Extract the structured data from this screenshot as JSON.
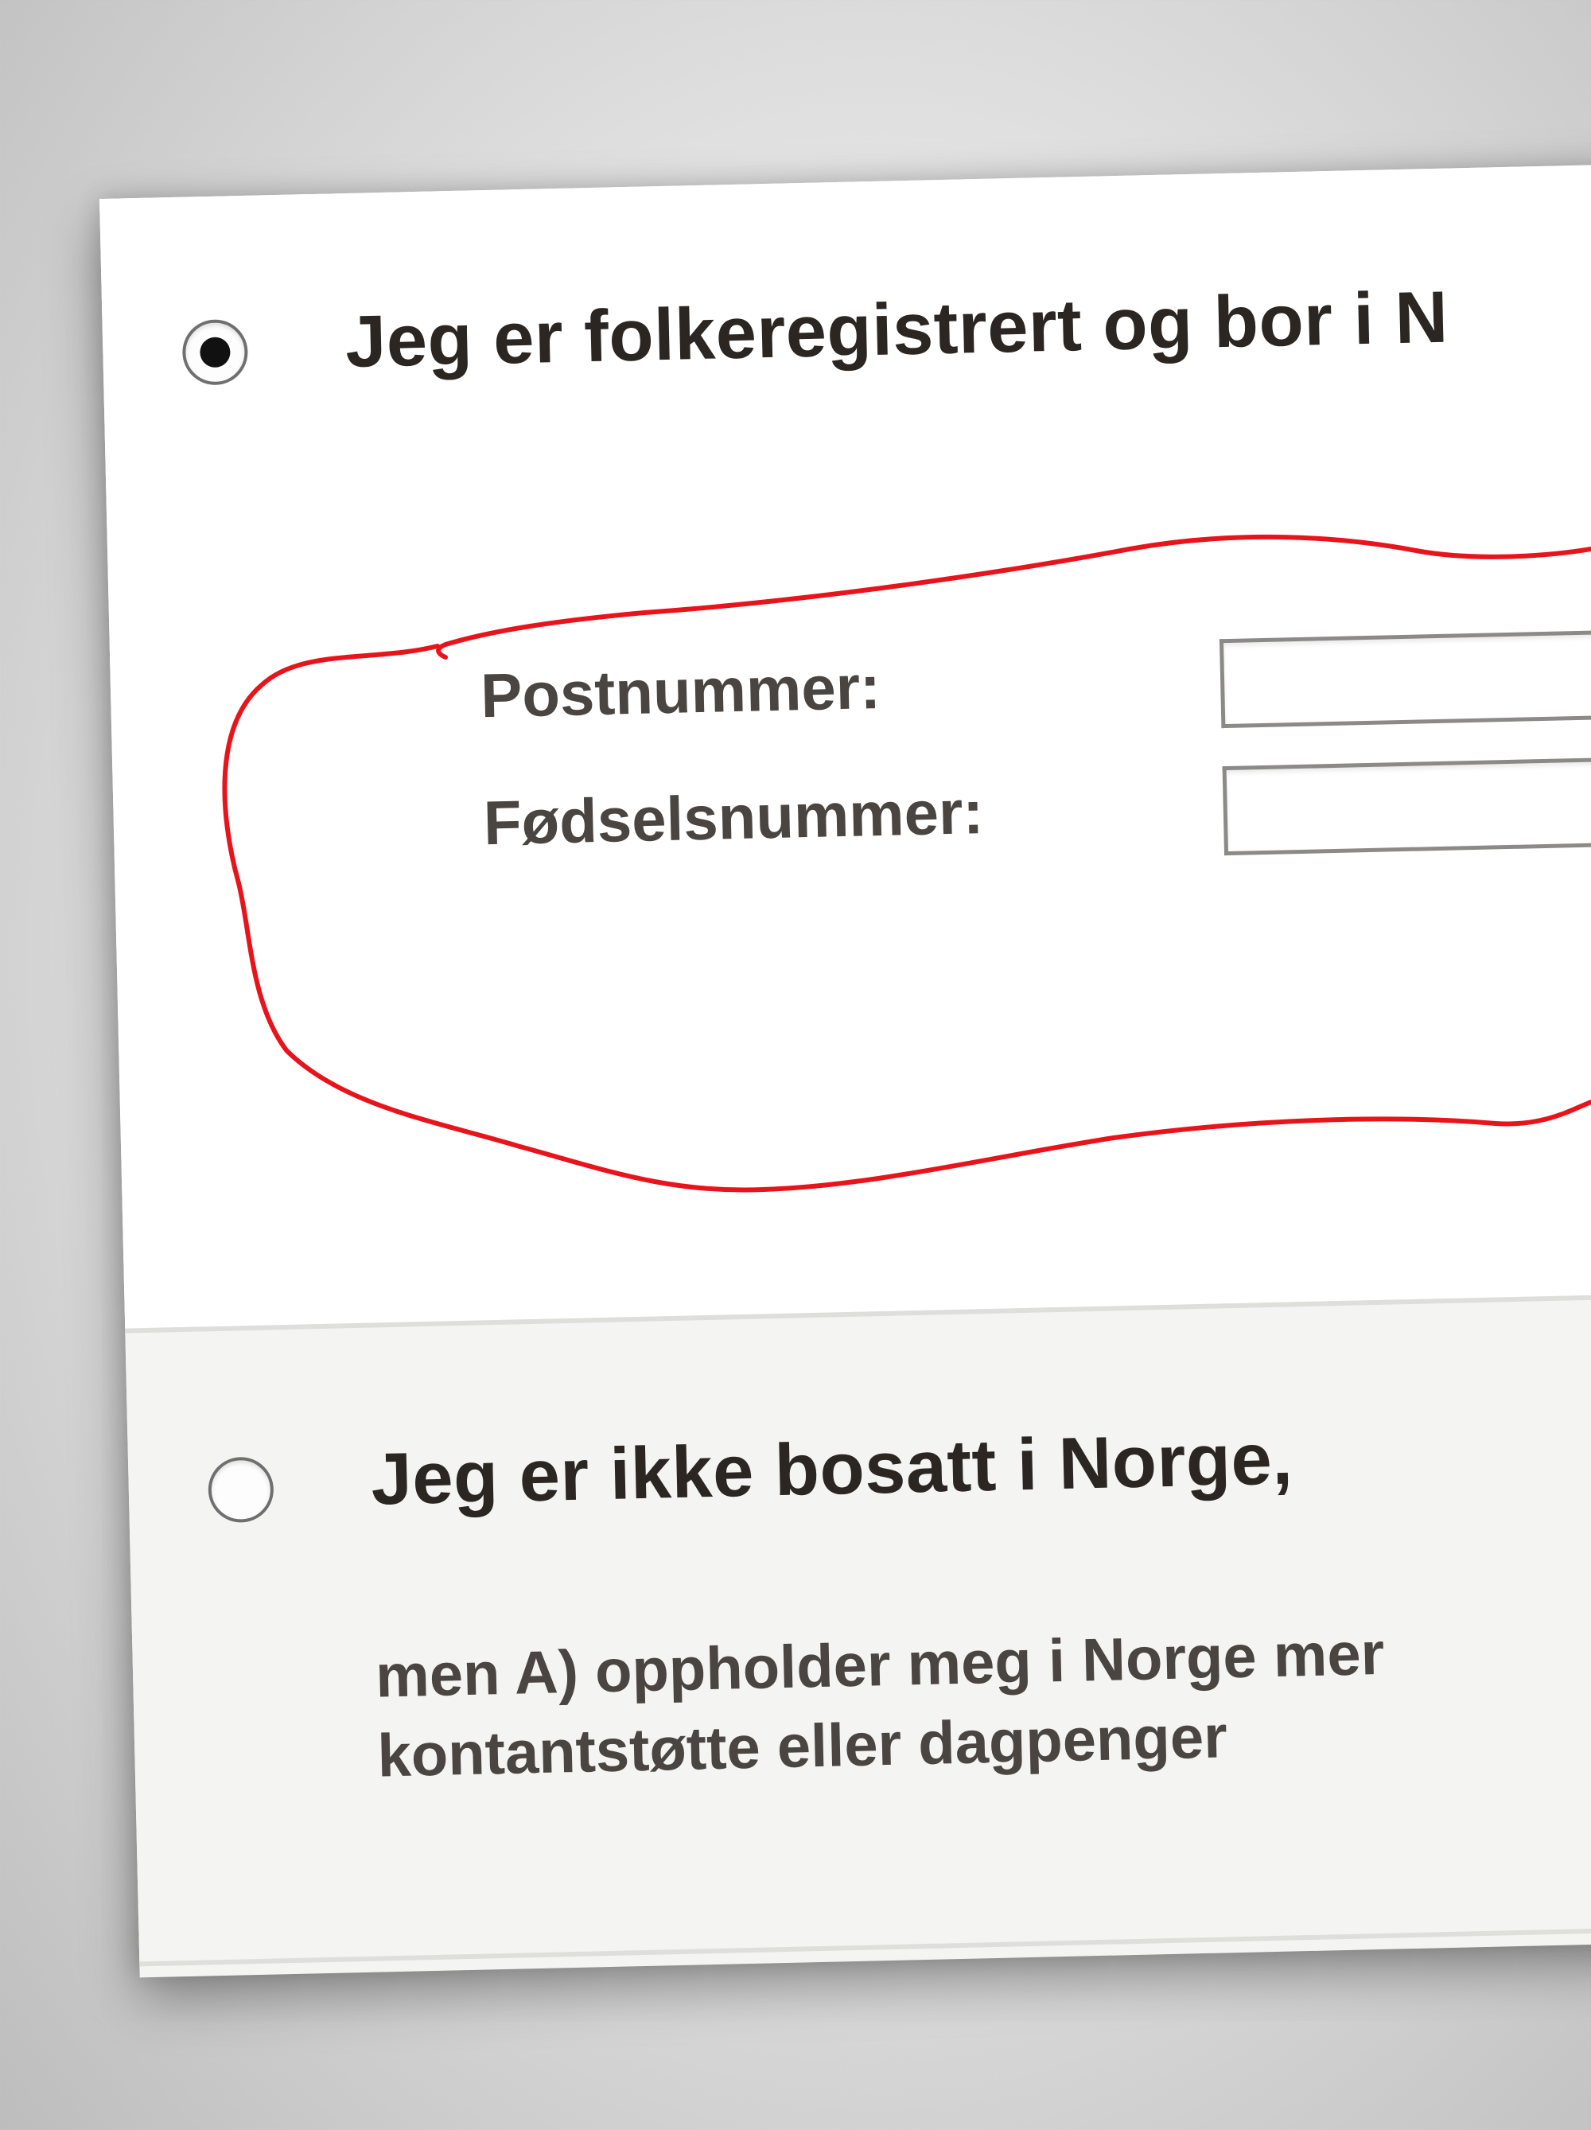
{
  "options": [
    {
      "label": "Jeg er folkeregistrert og bor i N",
      "selected": true
    },
    {
      "label": "Jeg er ikke bosatt i Norge,",
      "selected": false,
      "description": [
        "men A) oppholder meg i Norge mer",
        "kontantstøtte eller dagpenger"
      ]
    }
  ],
  "fields": {
    "postnummer": {
      "label": "Postnummer:",
      "value": ""
    },
    "fodselsnummer": {
      "label": "Fødselsnummer:",
      "value": ""
    }
  },
  "annotation": {
    "color": "#e8141c",
    "shape": "hand-drawn-circle"
  },
  "colors": {
    "text": "#2b2622",
    "label": "#4a4541",
    "alt_section_bg": "#f4f4f2"
  }
}
